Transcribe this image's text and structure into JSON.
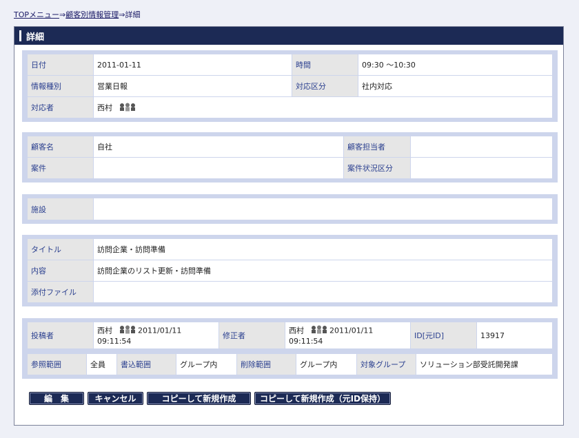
{
  "breadcrumb": {
    "top_menu": "TOPメニュー",
    "sep1": "⇒",
    "customer_info": "顧客別情報管理",
    "sep2": "⇒",
    "current": "詳細"
  },
  "panel": {
    "title": "詳細"
  },
  "section1": {
    "date_label": "日付",
    "date_value": "2011-01-11",
    "time_label": "時間",
    "time_value": "09:30 〜10:30",
    "info_type_label": "情報種別",
    "info_type_value": "営業日報",
    "response_type_label": "対応区分",
    "response_type_value": "社内対応",
    "responder_label": "対応者",
    "responder_value": "西村"
  },
  "section2": {
    "customer_label": "顧客名",
    "customer_value": "自社",
    "customer_rep_label": "顧客担当者",
    "customer_rep_value": "",
    "case_label": "案件",
    "case_value": "",
    "case_status_label": "案件状況区分",
    "case_status_value": ""
  },
  "section3": {
    "facility_label": "施設",
    "facility_value": ""
  },
  "section4": {
    "title_label": "タイトル",
    "title_value": "訪問企業・訪問準備",
    "content_label": "内容",
    "content_value": "訪問企業のリスト更新・訪問準備",
    "attachment_label": "添付ファイル",
    "attachment_value": ""
  },
  "section5": {
    "poster_label": "投稿者",
    "poster_name": "西村",
    "poster_date": "2011/01/11",
    "poster_time": "09:11:54",
    "modifier_label": "修正者",
    "modifier_name": "西村",
    "modifier_date": "2011/01/11",
    "modifier_time": "09:11:54",
    "id_label": "ID[元ID]",
    "id_value": "13917",
    "view_scope_label": "参照範囲",
    "view_scope_value": "全員",
    "write_scope_label": "書込範囲",
    "write_scope_value": "グループ内",
    "delete_scope_label": "削除範囲",
    "delete_scope_value": "グループ内",
    "target_group_label": "対象グループ",
    "target_group_value": "ソリューション部受託開発課"
  },
  "buttons": {
    "edit": "編　集",
    "cancel": "キャンセル",
    "copy_new": "コピーして新規作成",
    "copy_new_keep_id": "コピーして新規作成（元ID保持）"
  },
  "icons": {
    "user_group": "user-group-icon"
  },
  "colors": {
    "header_bg": "#1c2a55",
    "group_bg": "#cdd5ec",
    "label_text": "#2a3f8f"
  }
}
